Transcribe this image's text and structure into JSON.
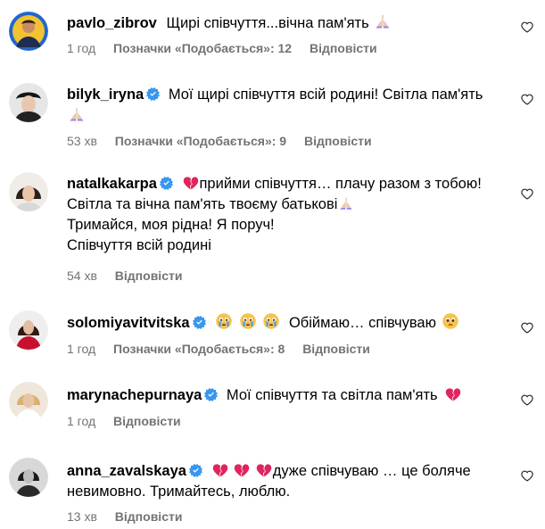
{
  "colors": {
    "verified": "#3897f0",
    "meta_text": "#737373",
    "broken_heart": "#e0245e"
  },
  "comments": [
    {
      "username": "pavlo_zibrov",
      "text": "Щирі співчуття...вічна пам'ять",
      "time": "1 год",
      "likes_label": "Позначки «Подобається»: 12",
      "reply_label": "Відповісти"
    },
    {
      "username": "bilyk_iryna",
      "text": "Мої щирі співчуття всій родині! Світла пам'ять",
      "time": "53 хв",
      "likes_label": "Позначки «Подобається»: 9",
      "reply_label": "Відповісти"
    },
    {
      "username": "natalkakarpa",
      "text": "прийми співчуття… плачу разом з тобою!",
      "line2": "Світла та вічна пам'ять твоєму батькові",
      "line3": "Тримайся, моя рідна! Я поруч!",
      "line4": "Співчуття всій родині",
      "time": "54 хв",
      "reply_label": "Відповісти"
    },
    {
      "username": "solomiyavitvitska",
      "text": "Обіймаю… співчуваю",
      "time": "1 год",
      "likes_label": "Позначки «Подобається»: 8",
      "reply_label": "Відповісти"
    },
    {
      "username": "marynachepurnaya",
      "text": "Мої співчуття та світла пам'ять",
      "time": "1 год",
      "reply_label": "Відповісти"
    },
    {
      "username": "anna_zavalskaya",
      "text": "дуже співчуваю … це боляче",
      "line2": "невимовно. Тримайтесь, люблю.",
      "time": "13 хв",
      "reply_label": "Відповісти"
    }
  ]
}
